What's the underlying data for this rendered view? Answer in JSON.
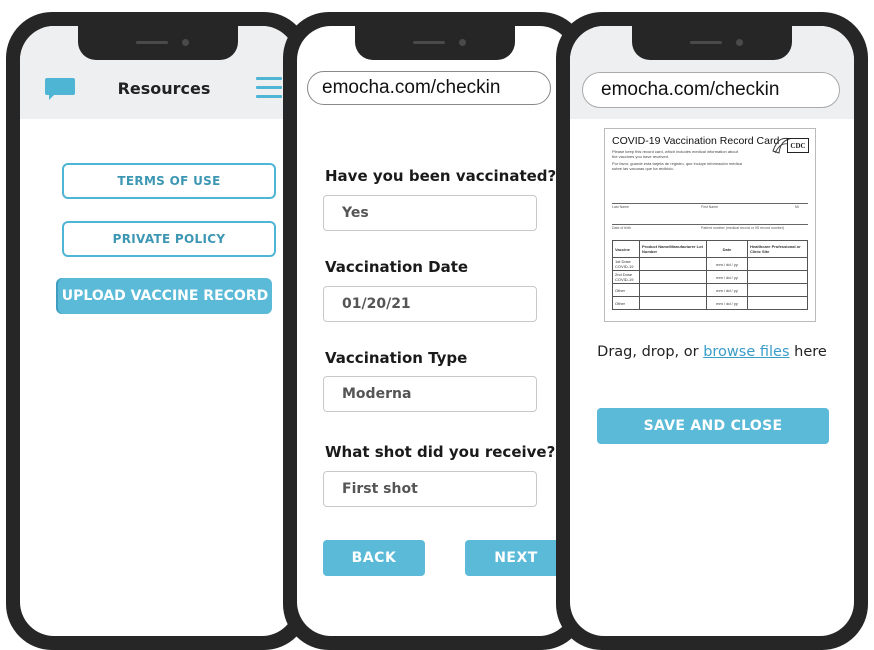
{
  "resources_screen": {
    "title": "Resources",
    "buttons": {
      "terms": "TERMS OF USE",
      "privacy": "PRIVATE POLICY",
      "upload": "UPLOAD VACCINE RECORD"
    },
    "icons": [
      "chat-bubble-icon",
      "hamburger-menu-icon"
    ],
    "accent_color": "#4fb5d4"
  },
  "checkin_screen": {
    "url": "emocha.com/checkin",
    "questions": [
      {
        "label": "Have you been vaccinated?",
        "value": "Yes"
      },
      {
        "label": "Vaccination Date",
        "value": "01/20/21"
      },
      {
        "label": "Vaccination Type",
        "value": "Moderna"
      },
      {
        "label": "What shot did you receive?",
        "value": "First shot"
      }
    ],
    "back_label": "BACK",
    "next_label": "NEXT"
  },
  "upload_screen": {
    "url": "emocha.com/checkin",
    "card": {
      "title": "COVID-19 Vaccination Record Card",
      "logo_text": "CDC",
      "note_en": "Please keep this record card, which includes medical information about the vaccines you have received.",
      "note_es": "Por favor, guarde esta tarjeta de registro, que incluye información médica sobre las vacunas que ha recibido.",
      "fields": {
        "last_name": "Last Name",
        "first_name": "First Name",
        "mi": "MI",
        "dob": "Date of birth",
        "patient_number": "Patient number (medical record or IIS record number)"
      },
      "table_headers": [
        "Vaccine",
        "Product Name/Manufacturer Lot Number",
        "Date",
        "Healthcare Professional or Clinic Site"
      ],
      "rows": [
        "1st Dose COVID-19",
        "2nd Dose COVID-19",
        "Other",
        "Other"
      ],
      "date_placeholder": "mm / dd / yy"
    },
    "drag_prefix": "Drag, drop, or ",
    "browse_link": "browse files",
    "drag_suffix": " here",
    "save_label": "SAVE AND CLOSE"
  }
}
